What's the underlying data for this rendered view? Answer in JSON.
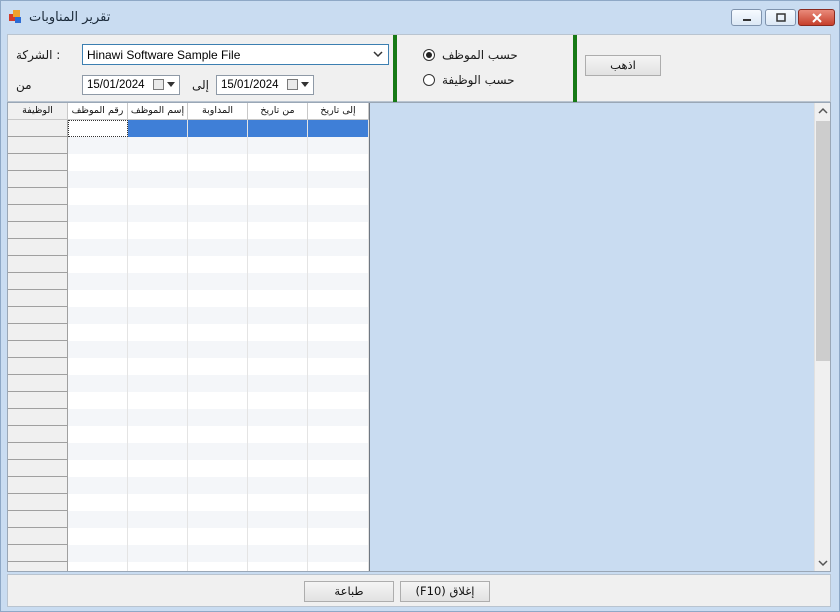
{
  "window": {
    "title": "تقرير المناوبات",
    "icons": {
      "app": "app-window-icon",
      "minimize": "minimize-icon",
      "maximize": "maximize-icon",
      "close": "close-icon"
    }
  },
  "filters": {
    "company_label": "الشركة :",
    "company_value": "Hinawi Software Sample File",
    "from_label": "من",
    "from_date": "15/01/2024",
    "to_label": "إلى",
    "to_date": "15/01/2024"
  },
  "grouping": {
    "by_employee_label": "حسب الموظف",
    "by_job_label": "حسب الوظيفة",
    "selected": "by_employee"
  },
  "go_button": "اذهب",
  "grid": {
    "columns": [
      "إلى تاريخ",
      "من تاريخ",
      "المداوبة",
      "إسم الموظف",
      "رقم الموظف",
      "الوظيفة"
    ],
    "selected_row": 1
  },
  "footer": {
    "print_button": "طباعة",
    "close_button": "(F10) إغلاق"
  },
  "colors": {
    "accent_green": "#167a16",
    "selected_row": "#3f7fd7",
    "window_bg": "#c9dcf1"
  }
}
